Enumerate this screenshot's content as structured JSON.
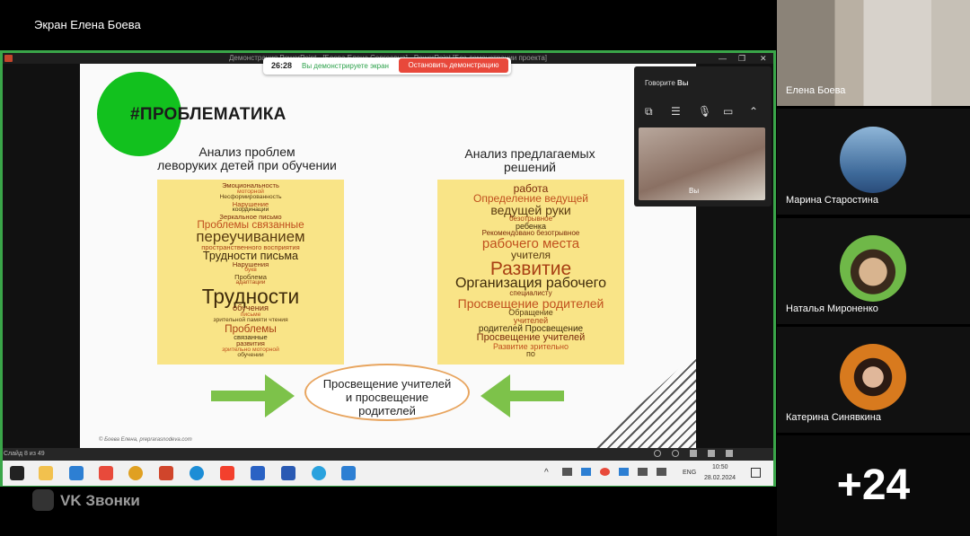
{
  "share": {
    "title": "Экран Елена Боева",
    "ppt_window_title": "Демонстрация PowerPoint - [Боева Елена Сергеевна] - PowerPoint [Без демонстрации проекта]",
    "timer": "26:28",
    "sharing_message": "Вы демонстрируете экран",
    "stop_label": "Остановить демонстрацию"
  },
  "slide": {
    "title": "#ПРОБЛЕМАТИКА",
    "left_heading": "Анализ проблем\nлеворуких детей при обучении",
    "right_heading": "Анализ  предлагаемых\nрешений",
    "center_text": "Просвещение учителей\nи просвещение\nродителей",
    "credit": "© Боева Елена, preprarasnodeva.com",
    "slide_counter": "Слайд 8 из 49",
    "cloud_left": [
      {
        "t": "Эмоциональность",
        "s": 9
      },
      {
        "t": "моторной",
        "s": 8
      },
      {
        "t": "Несформированность",
        "s": 8
      },
      {
        "t": "Нарушение",
        "s": 9
      },
      {
        "t": "координации",
        "s": 8
      },
      {
        "t": "Зеркальное  письмо",
        "s": 9
      },
      {
        "t": "Проблемы  связанные",
        "s": 14
      },
      {
        "t": "переучиванием",
        "s": 20
      },
      {
        "t": "пространственного  восприятия",
        "s": 9
      },
      {
        "t": "Трудности  письма",
        "s": 15
      },
      {
        "t": "Нарушения",
        "s": 9
      },
      {
        "t": "букв",
        "s": 8
      },
      {
        "t": "Проблема",
        "s": 9
      },
      {
        "t": "адаптации",
        "s": 8
      },
      {
        "t": "Трудности",
        "s": 27
      },
      {
        "t": "обучения",
        "s": 11
      },
      {
        "t": "письме",
        "s": 8
      },
      {
        "t": "зрительной  памяти  чтения",
        "s": 8
      },
      {
        "t": "Проблемы",
        "s": 14
      },
      {
        "t": "связанные",
        "s": 9
      },
      {
        "t": "развития",
        "s": 9
      },
      {
        "t": "зрительно  моторной",
        "s": 8
      },
      {
        "t": "обучении",
        "s": 8
      }
    ],
    "cloud_right": [
      {
        "t": "работа",
        "s": 12
      },
      {
        "t": "Определение  ведущей",
        "s": 12
      },
      {
        "t": "ведущей  руки",
        "s": 14
      },
      {
        "t": "безотрывное",
        "s": 8
      },
      {
        "t": "ребенка",
        "s": 9
      },
      {
        "t": "Рекомендовано  безотрывное",
        "s": 8
      },
      {
        "t": "рабочего  места",
        "s": 15
      },
      {
        "t": "учителя",
        "s": 12
      },
      {
        "t": "Развитие",
        "s": 21
      },
      {
        "t": "Организация  рабочего",
        "s": 16
      },
      {
        "t": "специалисту",
        "s": 8
      },
      {
        "t": "Просвещение  родителей",
        "s": 14
      },
      {
        "t": "Обращение",
        "s": 9
      },
      {
        "t": "учителей",
        "s": 9
      },
      {
        "t": "родителей  Просвещение",
        "s": 10
      },
      {
        "t": "Просвещение  учителей",
        "s": 11
      },
      {
        "t": "Развитие  зрительно",
        "s": 9
      },
      {
        "t": "по",
        "s": 9
      }
    ]
  },
  "taskbar": {
    "language": "ENG",
    "time": "10:50",
    "date": "28.02.2024",
    "icons": [
      "windows-icon",
      "explorer-icon",
      "mail-icon",
      "yandex-browser-icon",
      "chrome-icon",
      "powerpoint-icon",
      "edge-icon",
      "yandex-icon",
      "store-icon",
      "word-icon",
      "telegram-icon",
      "vk-app-icon"
    ]
  },
  "self_panel": {
    "speaking_prefix": "Говорите",
    "speaking_name": "Вы",
    "self_label": "Вы"
  },
  "participants": [
    {
      "name": "Елена Боева"
    },
    {
      "name": "Марина Старостина"
    },
    {
      "name": "Наталья Мироненко"
    },
    {
      "name": "Катерина Синявкина"
    }
  ],
  "more_count": "+24",
  "brand": "VK Звонки",
  "colors": {
    "accent_green": "#3aa649",
    "stop_red": "#e8483b",
    "cloud_yellow": "#f9e487",
    "slide_green": "#12c11e"
  }
}
